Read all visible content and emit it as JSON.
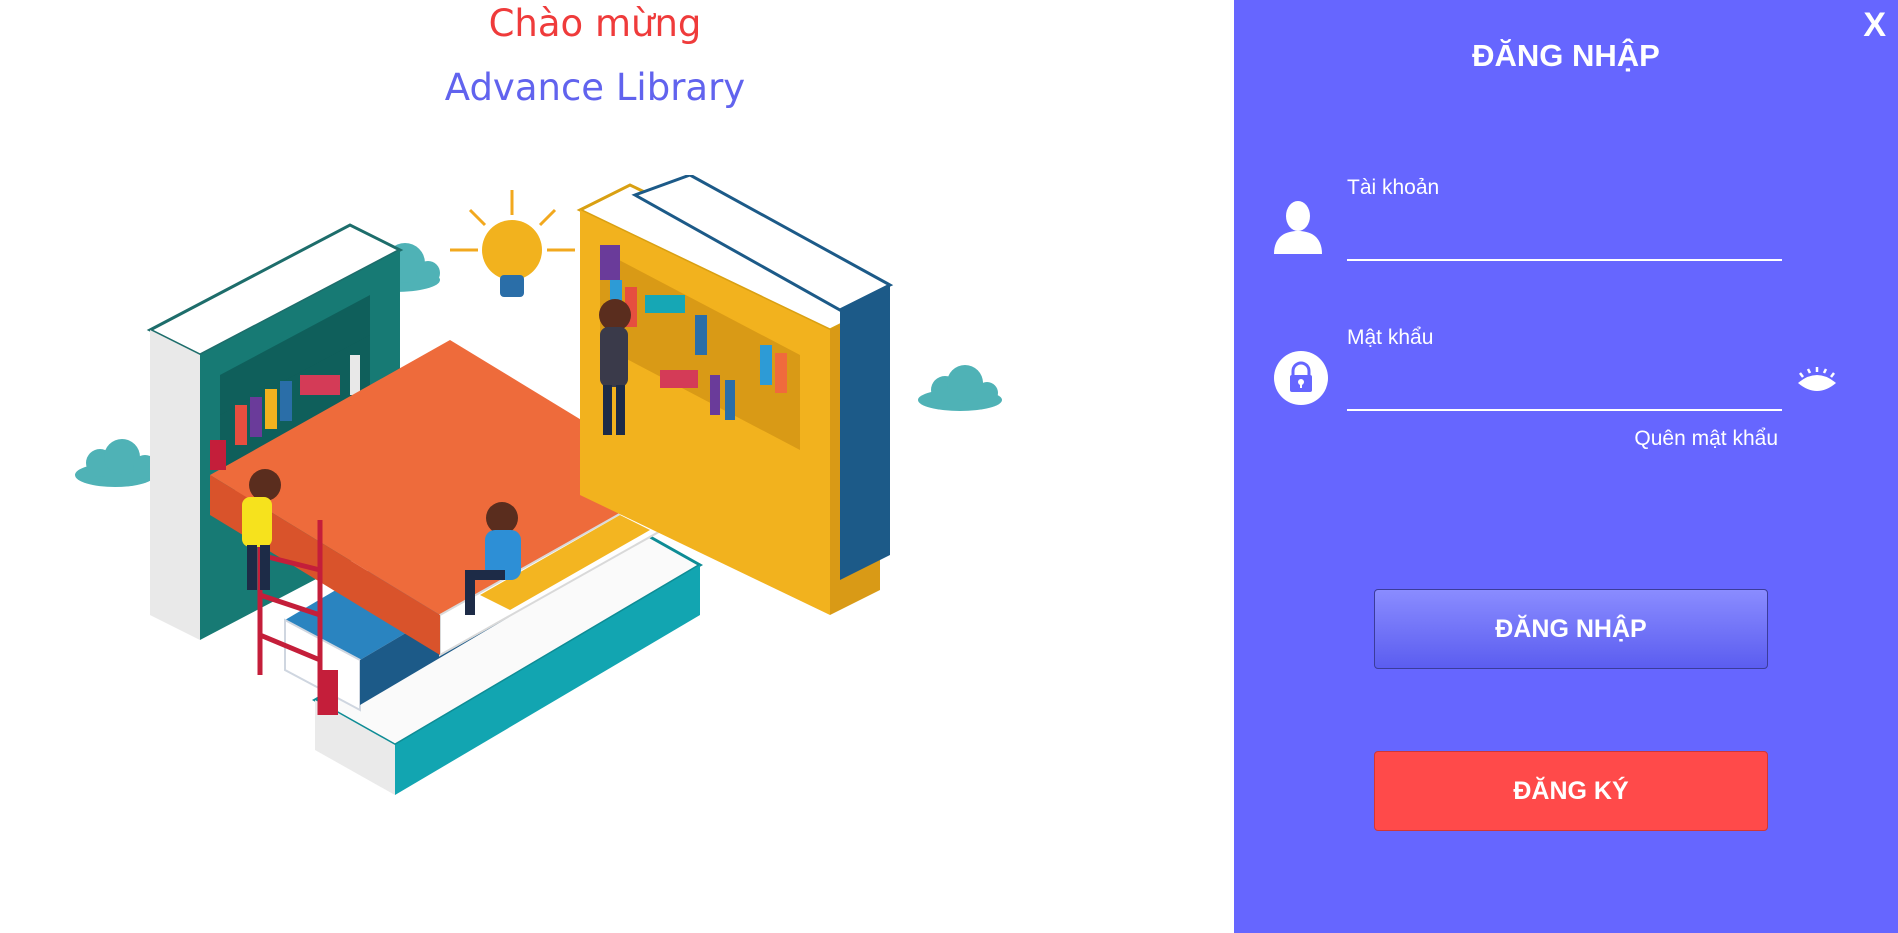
{
  "welcome": {
    "line1": "Chào mừng",
    "line2": "Advance Library"
  },
  "login_panel": {
    "close_label": "X",
    "title": "ĐĂNG NHẬP",
    "username": {
      "label": "Tài khoản",
      "value": ""
    },
    "password": {
      "label": "Mật khẩu",
      "value": ""
    },
    "forgot_password": "Quên mật khẩu",
    "login_button": "ĐĂNG NHẬP",
    "register_button": "ĐĂNG KÝ"
  },
  "icons": [
    "user-icon",
    "lock-icon",
    "eye-icon",
    "close-icon"
  ],
  "colors": {
    "panel_bg": "#6666ff",
    "welcome_red": "#ef3b3b",
    "welcome_blue": "#6163ee",
    "register_red": "#ff4a4a",
    "login_button_blue": "#7375f7"
  }
}
